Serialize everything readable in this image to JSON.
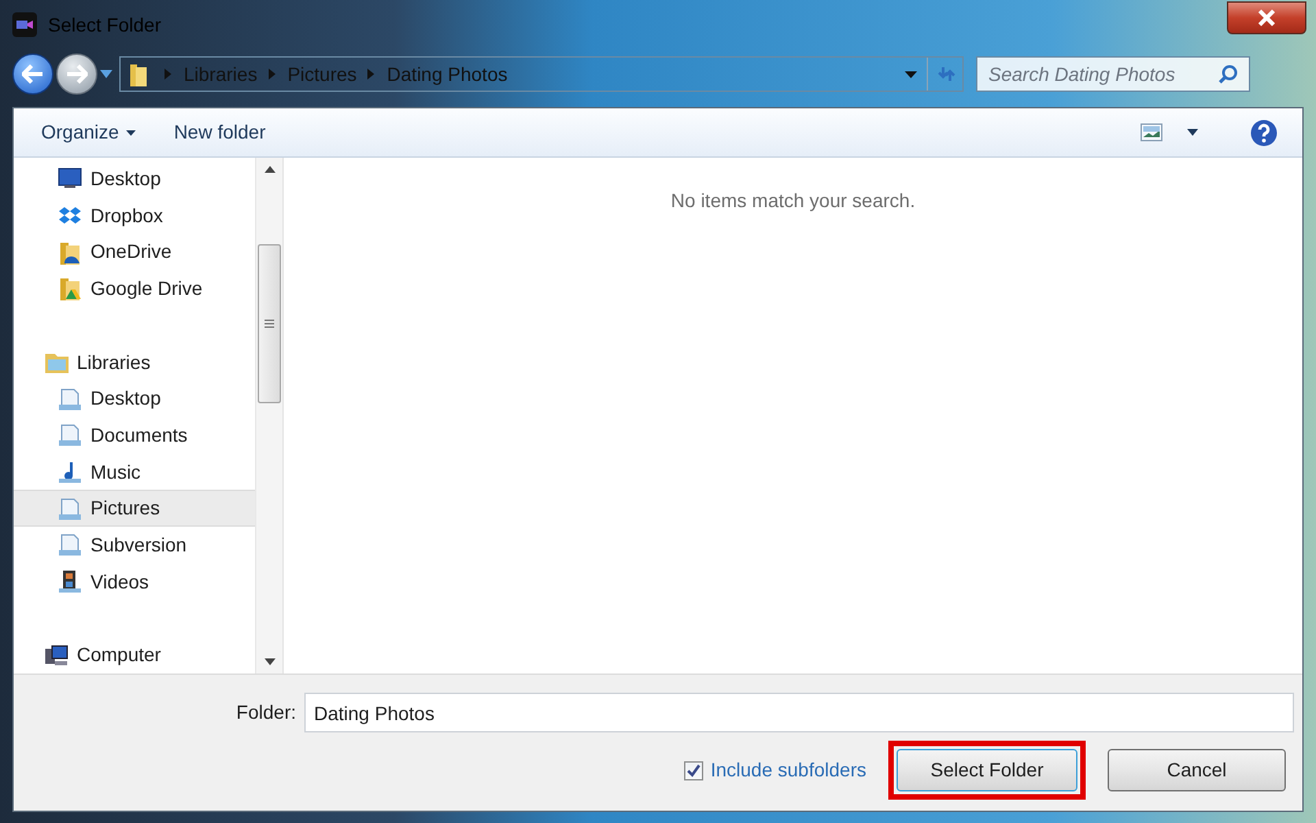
{
  "window": {
    "title": "Select Folder"
  },
  "breadcrumb": [
    "Libraries",
    "Pictures",
    "Dating Photos"
  ],
  "search": {
    "placeholder": "Search Dating Photos"
  },
  "toolbar": {
    "organize": "Organize",
    "new_folder": "New folder"
  },
  "nav": [
    {
      "children": [
        {
          "label": "Desktop",
          "selected": false
        },
        {
          "label": "Dropbox",
          "selected": false
        },
        {
          "label": "OneDrive",
          "selected": false
        },
        {
          "label": "Google Drive",
          "selected": false
        }
      ]
    },
    {
      "label": "Libraries",
      "selected": false,
      "children": [
        {
          "label": "Desktop",
          "selected": false
        },
        {
          "label": "Documents",
          "selected": false
        },
        {
          "label": "Music",
          "selected": false
        },
        {
          "label": "Pictures",
          "selected": true
        },
        {
          "label": "Subversion",
          "selected": false
        },
        {
          "label": "Videos",
          "selected": false
        }
      ]
    },
    {
      "label": "Computer",
      "selected": false
    }
  ],
  "empty_message": "No items match your search.",
  "folder_field": {
    "label": "Folder:",
    "value": "Dating Photos"
  },
  "include_subfolders": {
    "label": "Include subfolders",
    "checked": true
  },
  "buttons": [
    {
      "label": "Select Folder",
      "highlighted": true
    },
    {
      "label": "Cancel",
      "highlighted": false
    }
  ]
}
